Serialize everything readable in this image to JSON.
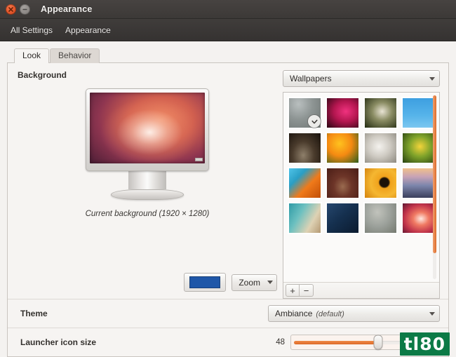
{
  "window": {
    "title": "Appearance",
    "close_icon": "close-icon",
    "minimize_icon": "minimize-icon"
  },
  "toolbar": {
    "items": [
      {
        "label": "All Settings"
      },
      {
        "label": "Appearance"
      }
    ]
  },
  "tabs": [
    {
      "label": "Look",
      "active": true
    },
    {
      "label": "Behavior",
      "active": false
    }
  ],
  "background": {
    "section_label": "Background",
    "caption": "Current background (1920 × 1280)",
    "color_swatch": "#1f57a8",
    "zoom_button": "Zoom",
    "monitor_wallpaper_colors": [
      "#3a1430",
      "#6e2540",
      "#c85f4e",
      "#e8876a"
    ]
  },
  "chooser": {
    "source_label": "Wallpapers",
    "add_button": "+",
    "remove_button": "−",
    "thumbnails": [
      {
        "name": "misty-grey-field",
        "selected": true,
        "css": "radial-gradient(ellipse at 30% 20%, #b9bfbf 0%, #8e9594 45%, #6d7472 100%)"
      },
      {
        "name": "magenta-flower",
        "selected": false,
        "css": "radial-gradient(ellipse at 60% 45%, #f0327f 0%, #b3164f 45%, #2a0713 100%)"
      },
      {
        "name": "white-blossoms",
        "selected": false,
        "css": "radial-gradient(ellipse at 55% 45%, #e9e4d4 0%, #8a8c63 40%, #21290f 100%)"
      },
      {
        "name": "blue-sky-birds",
        "selected": false,
        "css": "linear-gradient(to bottom, #3d9fe0 0%, #57b4ea 60%, #7cc7f0 100%)"
      },
      {
        "name": "dark-brown-texture",
        "selected": false,
        "css": "radial-gradient(ellipse at 45% 75%, #8e7f6a 0%, #4a3b2c 45%, #17100a 100%)"
      },
      {
        "name": "orange-poppy",
        "selected": false,
        "css": "radial-gradient(ellipse at 40% 35%, #ffc21e 0%, #f58a12 45%, #2c5d1c 100%)"
      },
      {
        "name": "white-butterfly",
        "selected": false,
        "css": "radial-gradient(ellipse at 45% 45%, #f4f2ee 0%, #cfcbc3 45%, #8d897f 100%)"
      },
      {
        "name": "green-yellow-plant",
        "selected": false,
        "css": "radial-gradient(ellipse at 55% 45%, #f2d43a 0%, #7ea22a 45%, #27410f 100%)"
      },
      {
        "name": "orange-blue-artwork",
        "selected": false,
        "css": "linear-gradient(135deg, #4fc3e8 0%, #2a9ec4 30%, #f07a1a 60%, #c14f08 100%)"
      },
      {
        "name": "maroon-minimal",
        "selected": false,
        "css": "radial-gradient(ellipse at 50% 62%, #9a6b4f 0%, #6d3528 40%, #4a1d16 100%)"
      },
      {
        "name": "orange-circular-pattern",
        "selected": false,
        "css": "radial-gradient(circle at 62% 48%, #1c1208 0%, #1c1208 18%, #f0a21c 24%, #f5b731 55%, #d4820d 100%)"
      },
      {
        "name": "dusk-landscape",
        "selected": false,
        "css": "linear-gradient(to bottom, #f0c08a 0%, #c8a3b6 28%, #7d86ac 58%, #3a3f5c 100%)"
      },
      {
        "name": "teal-shells",
        "selected": false,
        "css": "linear-gradient(120deg, #2f9ba6 0%, #6cc0c0 35%, #ded2b4 70%, #b59a74 100%)"
      },
      {
        "name": "blue-fabric",
        "selected": false,
        "css": "linear-gradient(140deg, #26476e 0%, #15304f 45%, #0b1b2f 100%)"
      },
      {
        "name": "grey-mist",
        "selected": false,
        "css": "radial-gradient(ellipse at 40% 30%, #c1c3bc 0%, #9ba09a 50%, #74796f 100%)"
      },
      {
        "name": "red-glow-ubuntu",
        "selected": false,
        "css": "radial-gradient(ellipse at 58% 52%, #ffe8e0 0%, #f07a63 30%, #c0334a 65%, #5e1530 100%)"
      }
    ]
  },
  "theme": {
    "label": "Theme",
    "value": "Ambiance",
    "default_suffix": "(default)"
  },
  "launcher": {
    "label": "Launcher icon size",
    "value": "48"
  },
  "watermark": {
    "text": "tl80",
    "color": "#0c7a46"
  }
}
